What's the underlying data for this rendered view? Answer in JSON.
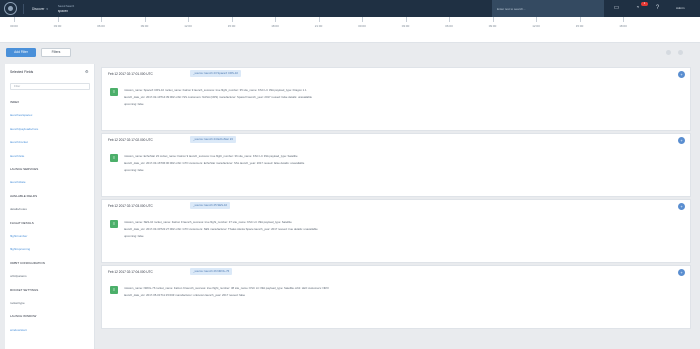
{
  "topbar": {
    "app_label": "Discover",
    "space_title": "Saved Search",
    "space_name": "spacex",
    "search_placeholder": "Enter text to search...",
    "notification_count": "1",
    "user_label": "Admin"
  },
  "timeline": {
    "ticks": [
      "00:00",
      "03:00",
      "06:00",
      "09:00",
      "12:00",
      "15:00",
      "18:00",
      "21:00",
      "00:00",
      "03:00",
      "06:00",
      "09:00",
      "12:00",
      "15:00",
      "18:00"
    ]
  },
  "actions": {
    "primary_label": "Add Filter",
    "secondary_label": "Filters"
  },
  "sidebar": {
    "title": "Selected Fields",
    "search_placeholder": "Filter",
    "entries": [
      {
        "kind": "cat",
        "text": "Index"
      },
      {
        "kind": "link",
        "text": "launches/spacex"
      },
      {
        "kind": "link",
        "text": "launch/payloads/core"
      },
      {
        "kind": "link",
        "text": "launch/rocket"
      },
      {
        "kind": "link",
        "text": "launch/site"
      },
      {
        "kind": "cat",
        "text": "Launch Services"
      },
      {
        "kind": "link",
        "text": "launch/date"
      },
      {
        "kind": "cat",
        "text": "Available Fields"
      },
      {
        "kind": "text",
        "text": "details/notes"
      },
      {
        "kind": "cat",
        "text": "Flight Details"
      },
      {
        "kind": "link",
        "text": "flight/number"
      },
      {
        "kind": "link",
        "text": "flight/upcoming"
      },
      {
        "kind": "cat",
        "text": "Orbit Configuration"
      },
      {
        "kind": "text",
        "text": "orbit/params"
      },
      {
        "kind": "cat",
        "text": "Rocket Settings"
      },
      {
        "kind": "text",
        "text": "rocket/type"
      },
      {
        "kind": "cat",
        "text": "Launch Window"
      },
      {
        "kind": "link",
        "text": "window/start"
      }
    ]
  },
  "documents": [
    {
      "title": "Feb 12 2017 02:17:01.000 UTC",
      "tag": "_source: launch 23 SpaceX CRS-10",
      "line1": "mission_name: SpaceX CRS-10   rocket_name: Falcon 9   launch_success: true   flight_number: 35   site_name: KSC LC 39A   payload_type: Dragon 1.1",
      "line2": "launch_date_utc: 2017-02-19T14:39:00Z   orbit: ISS   customers: NASA (CRS)   manufacturer: SpaceX   launch_year: 2017   reused: false   details: unavailable",
      "line3": "upcoming: false"
    },
    {
      "title": "Feb 12 2017 02:17:02.000 UTC",
      "tag": "_source: launch 24 EchoStar 23",
      "line1": "mission_name: EchoStar 23   rocket_name: Falcon 9   launch_success: true   flight_number: 36   site_name: KSC LC 39A   payload_type: Satellite",
      "line2": "launch_date_utc: 2017-03-16T06:00:00Z   orbit: GTO   customers: EchoStar   manufacturer: SSL   launch_year: 2017   reused: false   details: unavailable",
      "line3": "upcoming: false"
    },
    {
      "title": "Feb 12 2017 02:17:03.000 UTC",
      "tag": "_source: launch 25 SES-10",
      "line1": "mission_name: SES-10   rocket_name: Falcon 9   launch_success: true   flight_number: 37   site_name: KSC LC 39A   payload_type: Satellite",
      "line2": "launch_date_utc: 2017-03-30T22:27:00Z   orbit: GTO   customers: SES   manufacturer: Thales Alenia Space   launch_year: 2017   reused: true   details: unavailable",
      "line3": "upcoming: false"
    },
    {
      "title": "Feb 12 2017 02:17:04.000 UTC",
      "tag": "_source: launch 26 NROL-76",
      "line1": "mission_name: NROL-76   rocket_name: Falcon 9   launch_success: true   flight_number: 38   site_name: KSC LC 39A   payload_type: Satellite   orbit: LEO   customers: NRO",
      "line2": "launch_date_utc: 2017-05-01T11:15:00Z   manufacturer: unknown   launch_year: 2017   reused: false",
      "line3": ""
    }
  ]
}
